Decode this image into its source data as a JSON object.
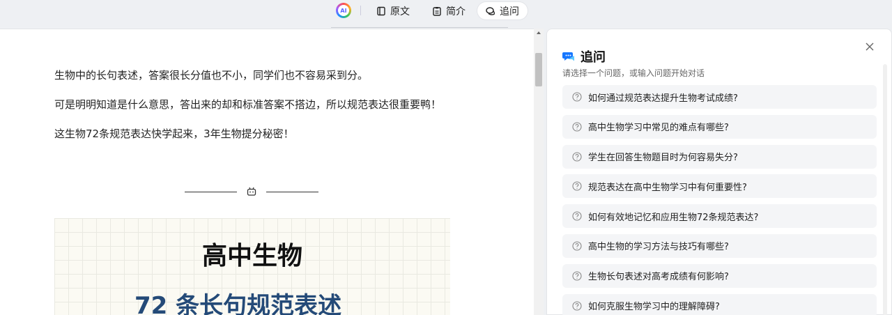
{
  "topbar": {
    "logo_text": "AI",
    "tabs": [
      {
        "label": "原文",
        "icon": "document-icon",
        "active": false
      },
      {
        "label": "简介",
        "icon": "clipboard-icon",
        "active": false
      },
      {
        "label": "追问",
        "icon": "chat-bubbles-icon",
        "active": true
      }
    ]
  },
  "doc": {
    "paragraphs": [
      "生物中的长句表述，答案很长分值也不小，同学们也不容易采到分。",
      "可是明明知道是什么意思，答出来的却和标准答案不搭边，所以规范表达很重要鸭！",
      "这生物72条规范表达快学起来，3年生物提分秘密！"
    ],
    "poster": {
      "title": "高中生物",
      "subtitle": "72 条长句规范表述"
    }
  },
  "panel": {
    "title": "追问",
    "subtitle": "请选择一个问题，或输入问题开始对话",
    "questions": [
      "如何通过规范表达提升生物考试成绩?",
      "高中生物学习中常见的难点有哪些?",
      "学生在回答生物题目时为何容易失分?",
      "规范表达在高中生物学习中有何重要性?",
      "如何有效地记忆和应用生物72条规范表达?",
      "高中生物的学习方法与技巧有哪些?",
      "生物长句表述对高考成绩有何影响?",
      "如何克服生物学习中的理解障碍?"
    ]
  },
  "colors": {
    "poster_subtitle": "#244a78",
    "accent": "#1677ff"
  }
}
